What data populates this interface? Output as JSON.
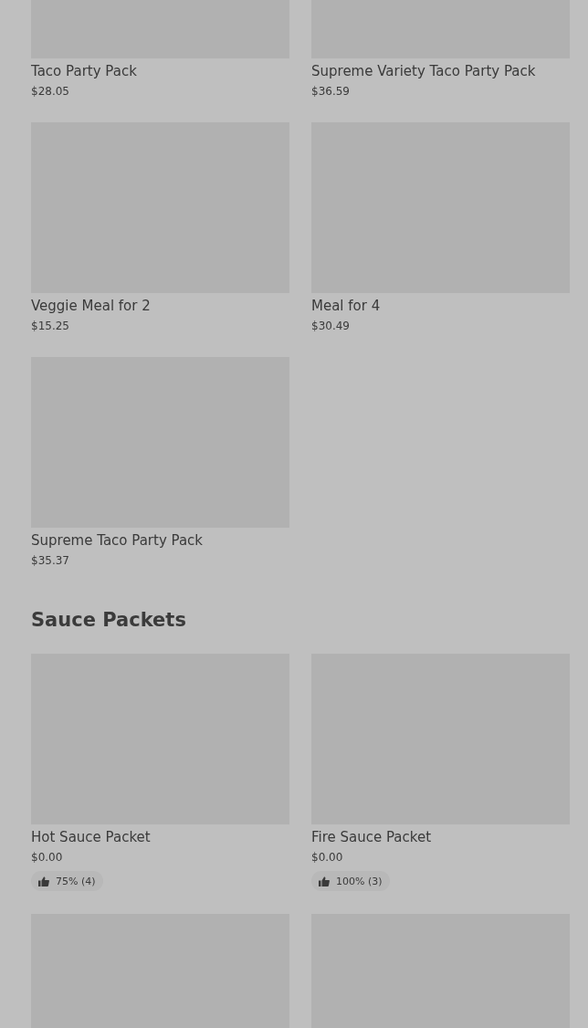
{
  "sections": [
    {
      "items": [
        {
          "name": "Taco Party Pack",
          "price": "$28.05"
        },
        {
          "name": "Supreme Variety Taco Party Pack",
          "price": "$36.59"
        },
        {
          "name": "Veggie Meal for 2",
          "price": "$15.25"
        },
        {
          "name": "Meal for 4",
          "price": "$30.49"
        },
        {
          "name": "Supreme Taco Party Pack",
          "price": "$35.37"
        }
      ]
    },
    {
      "title": "Sauce Packets",
      "items": [
        {
          "name": "Hot Sauce Packet",
          "price": "$0.00",
          "rating": "75% (4)"
        },
        {
          "name": "Fire Sauce Packet",
          "price": "$0.00",
          "rating": "100% (3)"
        },
        {
          "kind": "picture"
        },
        {
          "kind": "picture"
        }
      ]
    }
  ]
}
